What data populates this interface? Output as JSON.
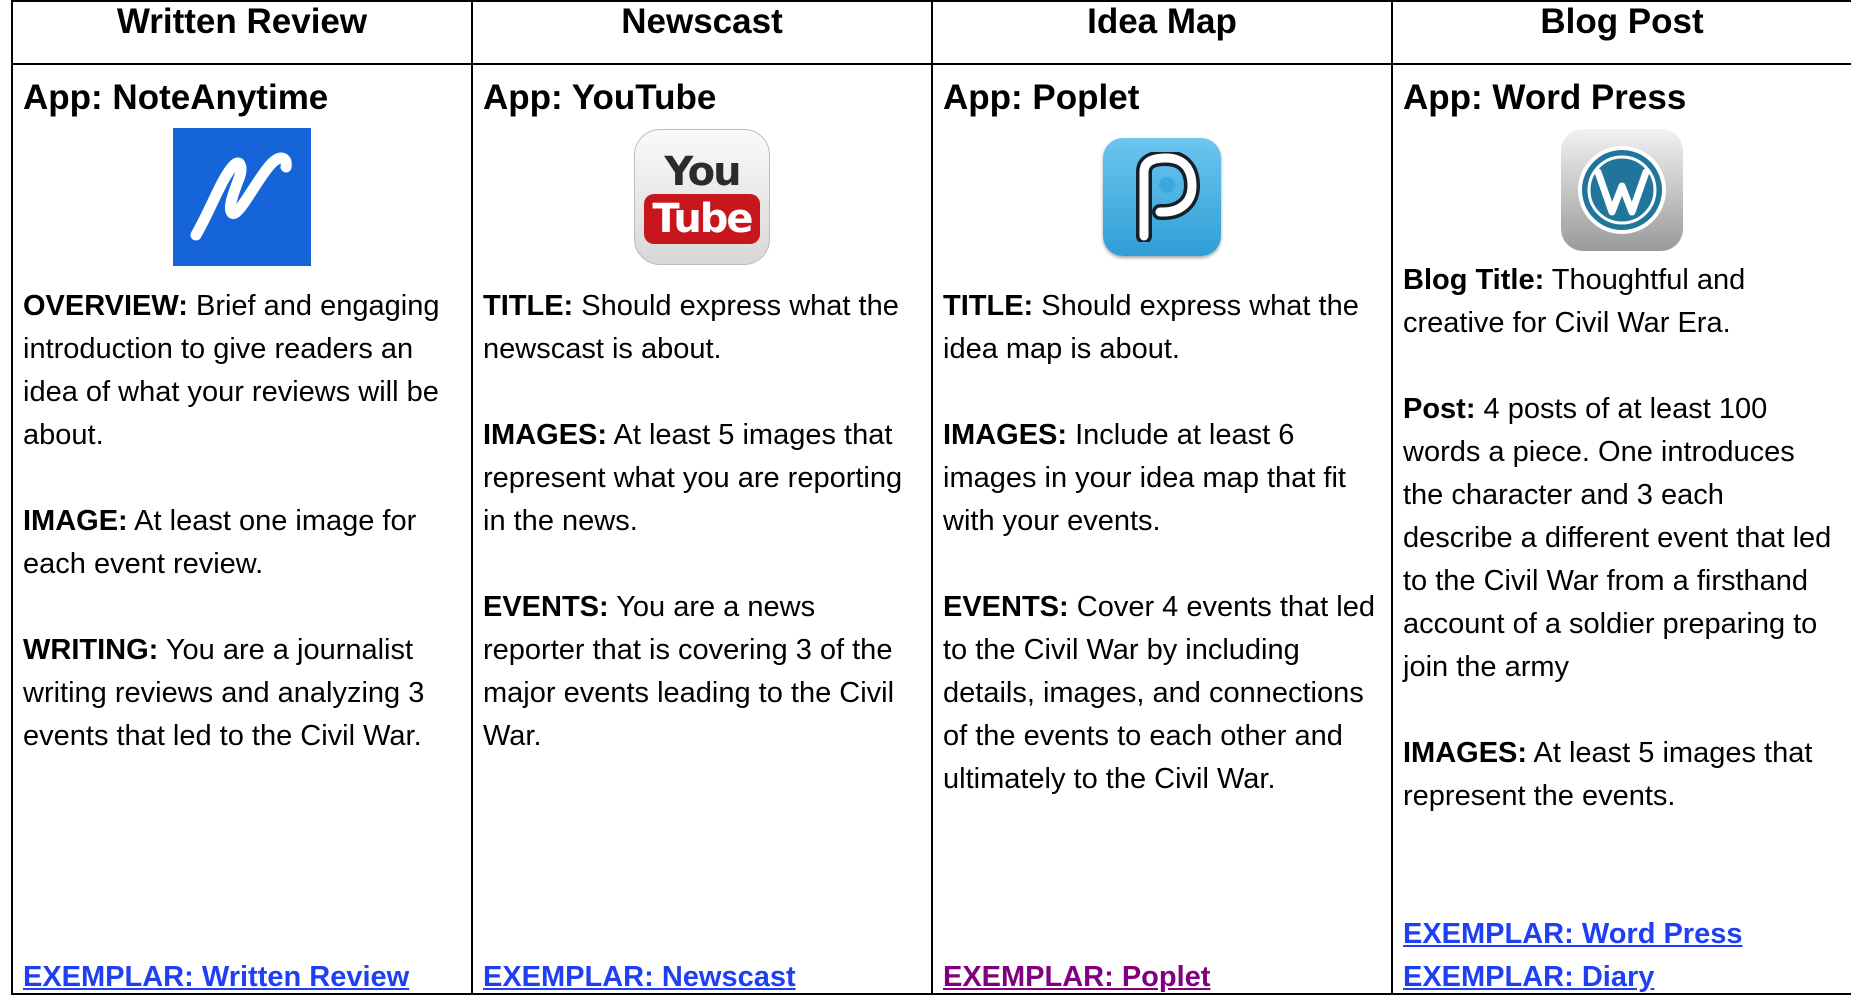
{
  "columns": [
    {
      "header": "Written Review",
      "app": "App: NoteAnytime",
      "icon": "noteanytime-icon",
      "paragraphs": [
        {
          "label": "OVERVIEW:",
          "text": " Brief and engaging introduction to give readers an idea of what your reviews will be about."
        },
        {
          "label": "IMAGE:",
          "text": " At least one image for each event review."
        },
        {
          "label": "WRITING:",
          "text": " You are a journalist writing reviews and analyzing 3 events that led to the Civil War."
        }
      ],
      "links": [
        "EXEMPLAR: Written Review"
      ]
    },
    {
      "header": "Newscast",
      "app": "App: YouTube",
      "icon": "youtube-icon",
      "icon_text": {
        "top": "You",
        "bottom": "Tube"
      },
      "paragraphs": [
        {
          "label": "TITLE:",
          "text": " Should express what the newscast is about."
        },
        {
          "label": "IMAGES:",
          "text": " At least 5 images that represent what you are reporting in the news."
        },
        {
          "label": "EVENTS:",
          "text": " You are a news reporter that is covering 3 of the major events leading to the Civil War."
        }
      ],
      "links": [
        "EXEMPLAR: Newscast"
      ]
    },
    {
      "header": "Idea Map",
      "app": "App: Poplet",
      "icon": "poplet-icon",
      "paragraphs": [
        {
          "label": "TITLE:",
          "text": " Should express what the idea map is about."
        },
        {
          "label": "IMAGES:",
          "text": " Include at least 6 images in your idea map that fit with your events."
        },
        {
          "label": "EVENTS:",
          "text": " Cover 4 events that led to the Civil War by including details, images, and connections of the events to each other and ultimately to the Civil War."
        }
      ],
      "links": [
        "EXEMPLAR: Poplet"
      ]
    },
    {
      "header": "Blog Post",
      "app": "App: Word Press",
      "icon": "wordpress-icon",
      "paragraphs": [
        {
          "label": "Blog Title:",
          "text": " Thoughtful and creative for Civil War Era."
        },
        {
          "label": "Post:",
          "text": " 4 posts of at least 100 words a piece. One introduces the character and 3 each describe a different event that led to the Civil War from a firsthand account of a soldier preparing to join the army"
        },
        {
          "label": "IMAGES:",
          "text": " At least 5 images that represent the events."
        }
      ],
      "links": [
        "EXEMPLAR: Word Press",
        "EXEMPLAR: Diary"
      ]
    }
  ],
  "colors": {
    "link": "#1f3ff5",
    "visited_link": "#800080",
    "noteanytime": "#1565d8",
    "youtube_red": "#c8161d",
    "poplet_blue": "#3aa9df",
    "wordpress_blue": "#21759b"
  }
}
